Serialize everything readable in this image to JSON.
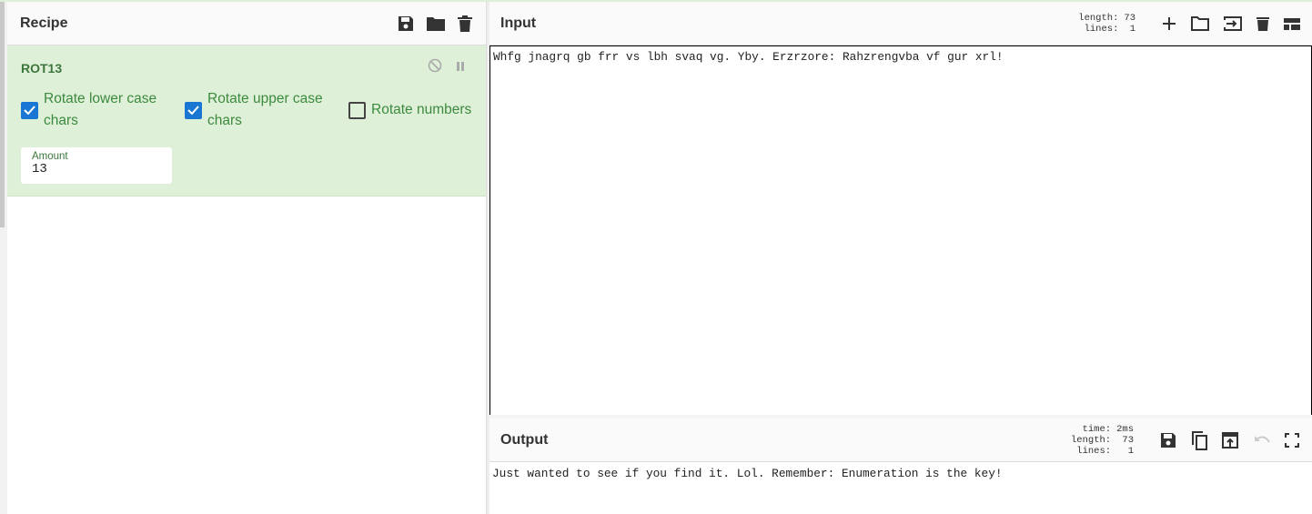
{
  "recipe": {
    "title": "Recipe",
    "operation": {
      "name": "ROT13",
      "options": [
        {
          "label": "Rotate lower case chars",
          "checked": true
        },
        {
          "label": "Rotate upper case chars",
          "checked": true
        },
        {
          "label": "Rotate numbers",
          "checked": false
        }
      ],
      "amount_label": "Amount",
      "amount_value": "13"
    }
  },
  "input": {
    "title": "Input",
    "length_label": "length:",
    "length": "73",
    "lines_label": "lines:",
    "lines": "1",
    "text": "Whfg jnagrq gb frr vs lbh svaq vg. Yby. Erzrzore: Rahzrengvba vf gur xrl!"
  },
  "output": {
    "title": "Output",
    "time_label": "time:",
    "time": "2ms",
    "length_label": "length:",
    "length": "73",
    "lines_label": "lines:",
    "lines": "1",
    "text": "Just wanted to see if you find it. Lol. Remember: Enumeration is the key!"
  }
}
